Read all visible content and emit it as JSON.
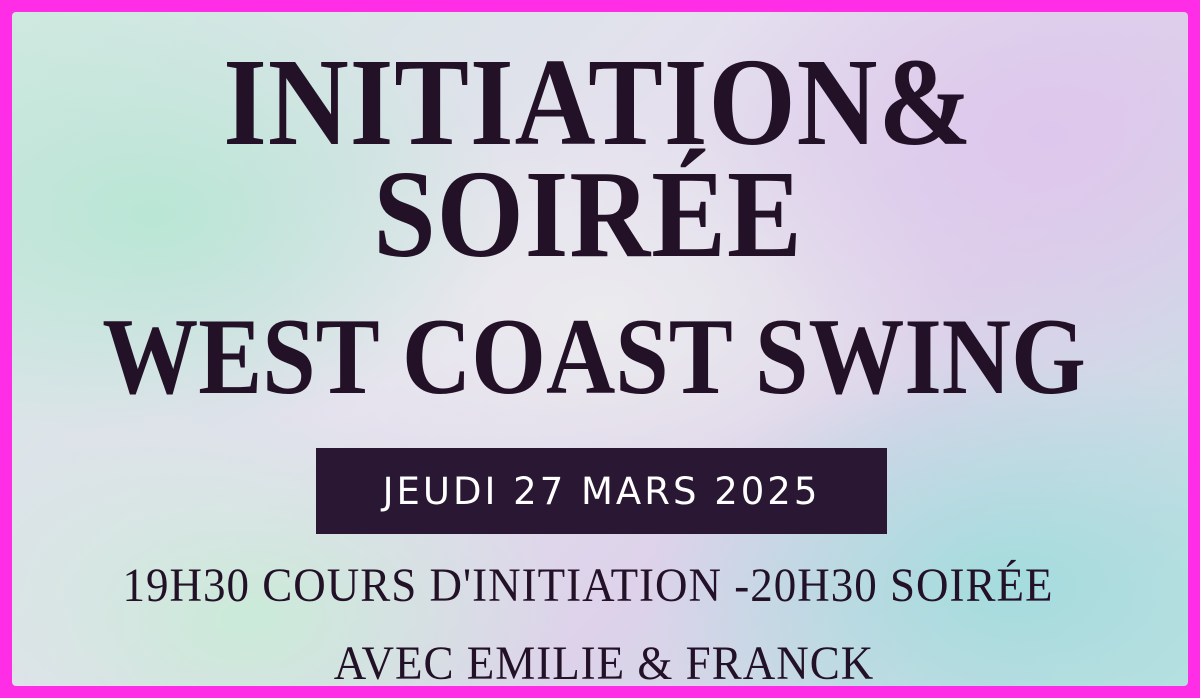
{
  "poster": {
    "title_line_1": "INITIATION&",
    "title_line_2": "SOIRÉE",
    "title_line_3": "WEST COAST SWING",
    "date": "JEUDI 27 MARS 2025",
    "schedule": "19H30 COURS D'INITIATION -20H30 SOIRÉE",
    "hosts": "AVEC EMILIE & FRANCK"
  },
  "colors": {
    "frame": "#ff2de6",
    "text": "#231128",
    "date_box": "#2a1733",
    "date_text": "#ffffff"
  }
}
